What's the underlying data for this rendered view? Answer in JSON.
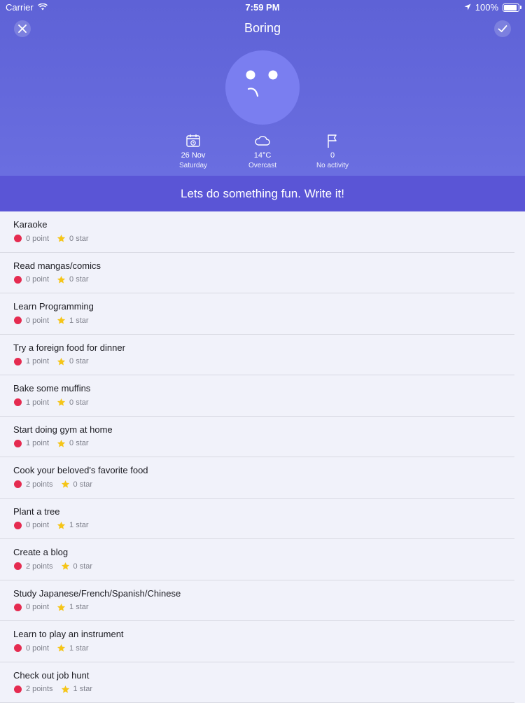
{
  "status_bar": {
    "carrier": "Carrier",
    "time": "7:59 PM",
    "battery": "100%",
    "battery_level": 1.0
  },
  "nav": {
    "title": "Boring"
  },
  "stats": [
    {
      "icon": "calendar-icon",
      "value": "26 Nov",
      "label": "Saturday"
    },
    {
      "icon": "cloud-icon",
      "value": "14°C",
      "label": "Overcast"
    },
    {
      "icon": "flag-icon",
      "value": "0",
      "label": "No activity"
    }
  ],
  "banner": {
    "text": "Lets do something fun. Write it!"
  },
  "activities": [
    {
      "title": "Karaoke",
      "points": "0 point",
      "stars": "0 star"
    },
    {
      "title": "Read mangas/comics",
      "points": "0 point",
      "stars": "0 star"
    },
    {
      "title": "Learn Programming",
      "points": "0 point",
      "stars": "1 star"
    },
    {
      "title": "Try a foreign food for dinner",
      "points": "1 point",
      "stars": "0 star"
    },
    {
      "title": "Bake some muffins",
      "points": "1 point",
      "stars": "0 star"
    },
    {
      "title": "Start doing gym at home",
      "points": "1 point",
      "stars": "0 star"
    },
    {
      "title": "Cook your beloved's favorite food",
      "points": "2 points",
      "stars": "0 star"
    },
    {
      "title": "Plant a tree",
      "points": "0 point",
      "stars": "1 star"
    },
    {
      "title": "Create a blog",
      "points": "2 points",
      "stars": "0 star"
    },
    {
      "title": "Study Japanese/French/Spanish/Chinese",
      "points": "0 point",
      "stars": "1 star"
    },
    {
      "title": "Learn to play an instrument",
      "points": "0 point",
      "stars": "1 star"
    },
    {
      "title": "Check out job hunt",
      "points": "2 points",
      "stars": "1 star"
    }
  ],
  "colors": {
    "header": "#5e62d6",
    "banner": "#5a55d6",
    "point_dot": "#e52b50",
    "star": "#f5c518"
  }
}
